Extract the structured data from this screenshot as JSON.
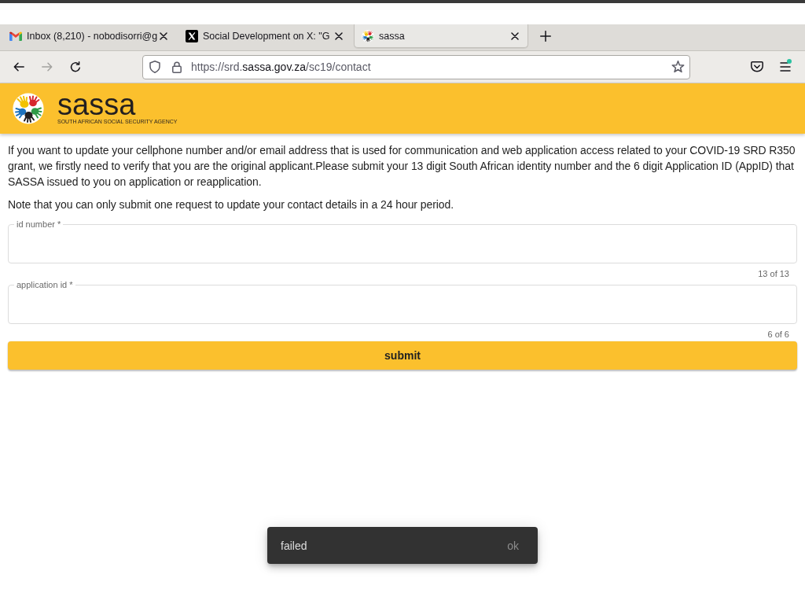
{
  "browser": {
    "tabs": [
      {
        "kind": "mail",
        "title": "Inbox (8,210) - nobodisorri@g",
        "selected": false
      },
      {
        "kind": "social",
        "title": "Social Development on X: \"G",
        "selected": false
      },
      {
        "kind": "site",
        "title": "sassa",
        "selected": true
      }
    ],
    "nav_buttons": [
      {
        "kind": "back",
        "disabled": false
      },
      {
        "kind": "forward",
        "disabled": true
      },
      {
        "kind": "reload",
        "disabled": false
      }
    ],
    "url": {
      "prefix": "https://srd.",
      "domain": "sassa.gov.za",
      "path": "/sc19/contact"
    },
    "menu_notification": true
  },
  "header": {
    "brand": "sassa",
    "tagline": "SOUTH AFRICAN SOCIAL SECURITY AGENCY"
  },
  "intro": [
    "If you want to update your cellphone number and/or email address that is used for communication and web application access related to your COVID-19 SRD R350 grant, we firstly need to verify that you are the original applicant.Please submit your 13 digit South African identity number and the 6 digit Application ID (AppID) that SASSA issued to you on application or reapplication.",
    "Note that you can only submit one request to update your contact details in a 24 hour period."
  ],
  "form": {
    "fields": [
      {
        "label": "id number *",
        "counter": "13 of 13"
      },
      {
        "label": "application id *",
        "counter": "6 of 6"
      }
    ],
    "submit": "submit"
  },
  "snackbar": {
    "message": "failed",
    "action": "ok"
  }
}
